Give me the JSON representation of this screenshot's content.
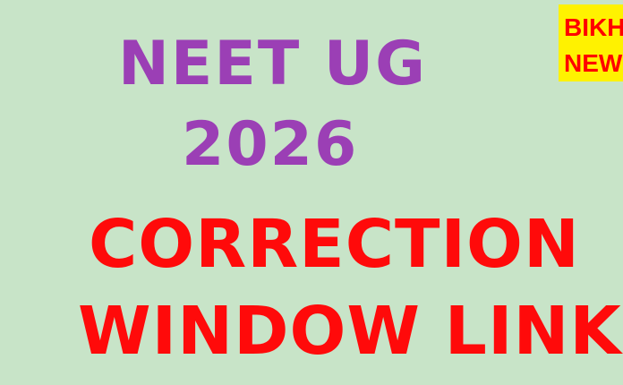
{
  "headline": {
    "line1": "NEET UG",
    "line2": "2026"
  },
  "subheadline": {
    "line1": "CORRECTION",
    "line2": "WINDOW LINK"
  },
  "badge": {
    "line1": "BIKH",
    "line2": "NEW"
  },
  "colors": {
    "background": "#c8e4c8",
    "headline": "#9b3fb5",
    "subheadline": "#ff0a0a",
    "badge_background": "#fff200",
    "badge_text": "#ff0000"
  }
}
